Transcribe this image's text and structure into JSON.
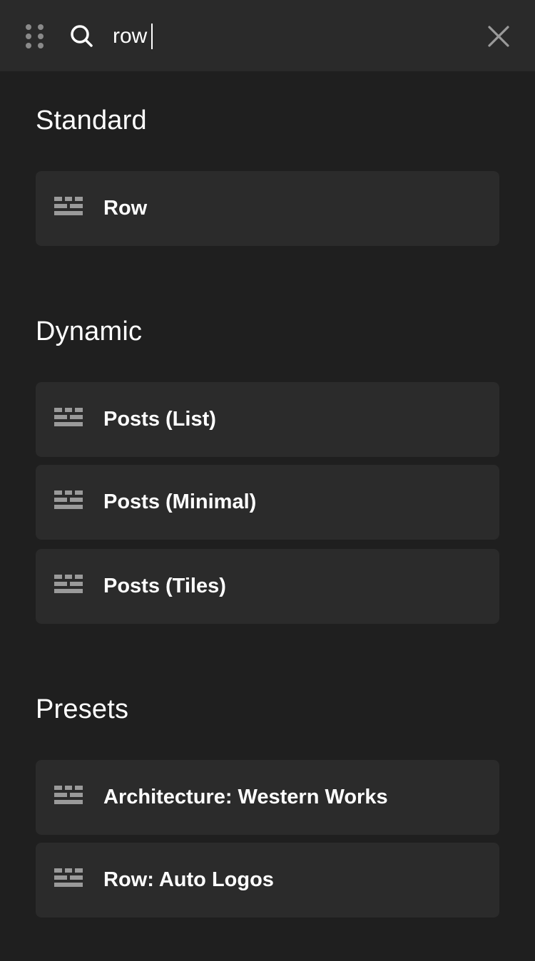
{
  "search": {
    "value": "row",
    "icon": "search-icon"
  },
  "header": {
    "drag_icon": "drag-handle-icon",
    "close_icon": "close-icon"
  },
  "sections": [
    {
      "title": "Standard",
      "items": [
        {
          "label": "Row",
          "icon": "row-layout-icon"
        }
      ]
    },
    {
      "title": "Dynamic",
      "items": [
        {
          "label": "Posts (List)",
          "icon": "row-layout-icon"
        },
        {
          "label": "Posts (Minimal)",
          "icon": "row-layout-icon"
        },
        {
          "label": "Posts (Tiles)",
          "icon": "row-layout-icon"
        }
      ]
    },
    {
      "title": "Presets",
      "items": [
        {
          "label": "Architecture: Western Works",
          "icon": "row-layout-icon"
        },
        {
          "label": "Row: Auto Logos",
          "icon": "row-layout-icon"
        }
      ]
    }
  ],
  "colors": {
    "background": "#1f1f1f",
    "topbar": "#2a2a2a",
    "item_background": "#2b2b2b",
    "text": "#ffffff",
    "icon": "#9a9a9a"
  }
}
